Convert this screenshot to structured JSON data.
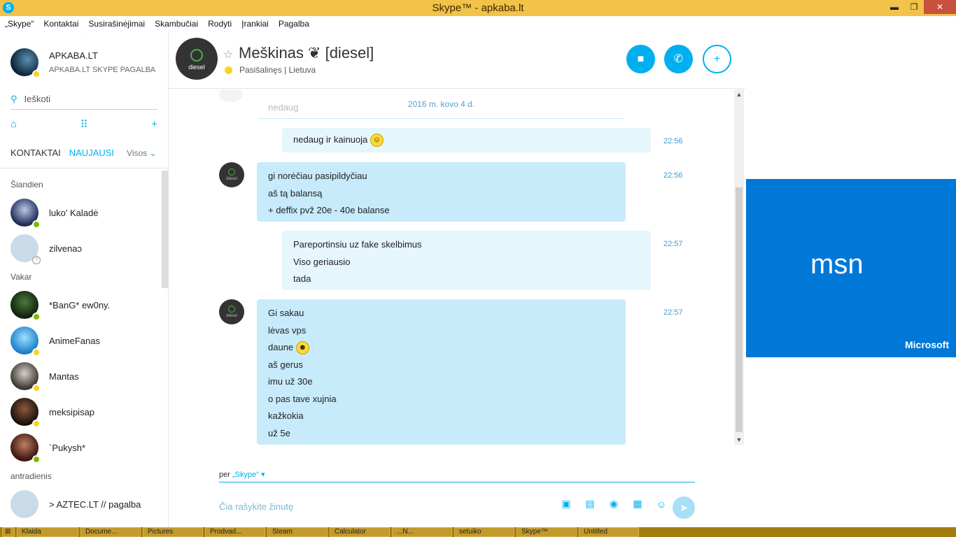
{
  "window": {
    "title": "Skype™ - apkaba.lt",
    "app_icon": "S",
    "minimize": "▬",
    "restore": "❐",
    "close": "✕"
  },
  "menu": [
    "„Skype“",
    "Kontaktai",
    "Susirašinėjimai",
    "Skambučiai",
    "Rodyti",
    "Įrankiai",
    "Pagalba"
  ],
  "profile": {
    "name": "APKABA.LT",
    "mood": "APKABA.LT SKYPE PAGALBA",
    "status_color": "#fdd024"
  },
  "search": {
    "icon": "search-icon",
    "placeholder": "Ieškoti"
  },
  "quick_actions": {
    "home": "⌂",
    "dialpad": "⠿",
    "add": "+"
  },
  "tabs": {
    "contacts": "KONTAKTAI",
    "recent": "NAUJAUSI",
    "filter": "Visos",
    "filter_chevron": "⌄"
  },
  "groups": {
    "today": "Šiandien",
    "yesterday": "Vakar",
    "tuesday": "antradienis"
  },
  "contacts_today": [
    {
      "name": "luko' Kaladė",
      "status": "online"
    },
    {
      "name": "zilvenaↄ",
      "status": "unknown"
    }
  ],
  "contacts_yesterday": [
    {
      "name": "*BanG* ew0ny.",
      "status": "online"
    },
    {
      "name": "AnimeFanas",
      "status": "away"
    },
    {
      "name": "Mantas",
      "status": "away"
    },
    {
      "name": "meksipisap",
      "status": "away"
    },
    {
      "name": "`Pukysh*",
      "status": "online"
    }
  ],
  "contacts_tuesday": [
    {
      "name": "> AZTEC.LT // pagalba",
      "status": "unknown"
    }
  ],
  "chat": {
    "peer_name": "Meškinas ❦ [diesel]",
    "peer_avatar_label": "diesel",
    "peer_status": "Pasišalinęs | Lietuva",
    "star": "☆",
    "video_icon": "■",
    "call_icon": "✆",
    "add_icon": "+"
  },
  "ghost_text": "nedaug",
  "date_separator": "2016 m. kovo 4 d.",
  "messages": [
    {
      "from": "me",
      "lines": [
        "nedaug ir kainuoja"
      ],
      "emoji": "☺",
      "time": "22:56"
    },
    {
      "from": "peer",
      "lines": [
        "gi norėčiau pasipildyčiau",
        "aš tą balansą",
        "+ deffix pvž 20e - 40e balanse"
      ],
      "time": "22:56"
    },
    {
      "from": "me",
      "lines": [
        "Pareportinsiu uz fake skelbimus",
        "Viso geriausio",
        "tada"
      ],
      "time": "22:57"
    },
    {
      "from": "peer",
      "lines": [
        "Gi sakau",
        "lėvas vps",
        "daune",
        "aš gerus",
        "imu už 30e",
        "o pas tave xujnia",
        "kažkokia",
        "už 5e"
      ],
      "time": "22:57"
    }
  ],
  "composer": {
    "via_prefix": "per",
    "via_service": "„Skype“",
    "via_chevron": "▾",
    "placeholder": "Čia rašykite žinutę",
    "send_icon": "➤"
  },
  "ad": {
    "logo_text": "msn",
    "brand": "Microsoft",
    "background": "#0078d7"
  },
  "taskbar": [
    "Klaida",
    "Docume...",
    "Pictures",
    "Prodvad...",
    "Steam",
    "Calculator",
    "...N...",
    "setuiko",
    "Skype™",
    "Untitled"
  ]
}
